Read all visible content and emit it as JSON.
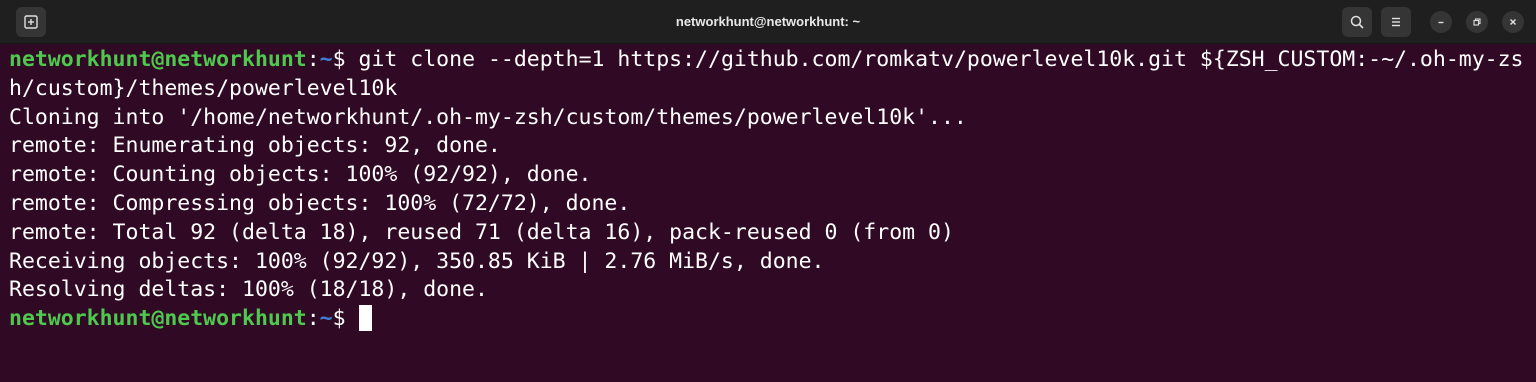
{
  "window": {
    "title": "networkhunt@networkhunt: ~"
  },
  "titlebar_icons": {
    "new_tab": "new-tab-icon",
    "search": "search-icon",
    "menu": "hamburger-menu-icon",
    "minimize": "minimize-icon",
    "maximize": "maximize-icon",
    "close": "close-icon"
  },
  "colors": {
    "background": "#300a24",
    "titlebar": "#1f1f1f",
    "prompt_user": "#4ec94e",
    "prompt_path": "#3e7fd6",
    "text": "#ffffff"
  },
  "terminal": {
    "prompt1": {
      "user_host": "networkhunt@networkhunt",
      "colon": ":",
      "path": "~",
      "symbol": "$ ",
      "command": "git clone --depth=1 https://github.com/romkatv/powerlevel10k.git ${ZSH_CUSTOM:-~/.oh-my-zs",
      "command_wrap": "h/custom}/themes/powerlevel10k"
    },
    "output": [
      "Cloning into '/home/networkhunt/.oh-my-zsh/custom/themes/powerlevel10k'...",
      "remote: Enumerating objects: 92, done.",
      "remote: Counting objects: 100% (92/92), done.",
      "remote: Compressing objects: 100% (72/72), done.",
      "remote: Total 92 (delta 18), reused 71 (delta 16), pack-reused 0 (from 0)",
      "Receiving objects: 100% (92/92), 350.85 KiB | 2.76 MiB/s, done.",
      "Resolving deltas: 100% (18/18), done."
    ],
    "prompt2": {
      "user_host": "networkhunt@networkhunt",
      "colon": ":",
      "path": "~",
      "symbol": "$ "
    }
  }
}
